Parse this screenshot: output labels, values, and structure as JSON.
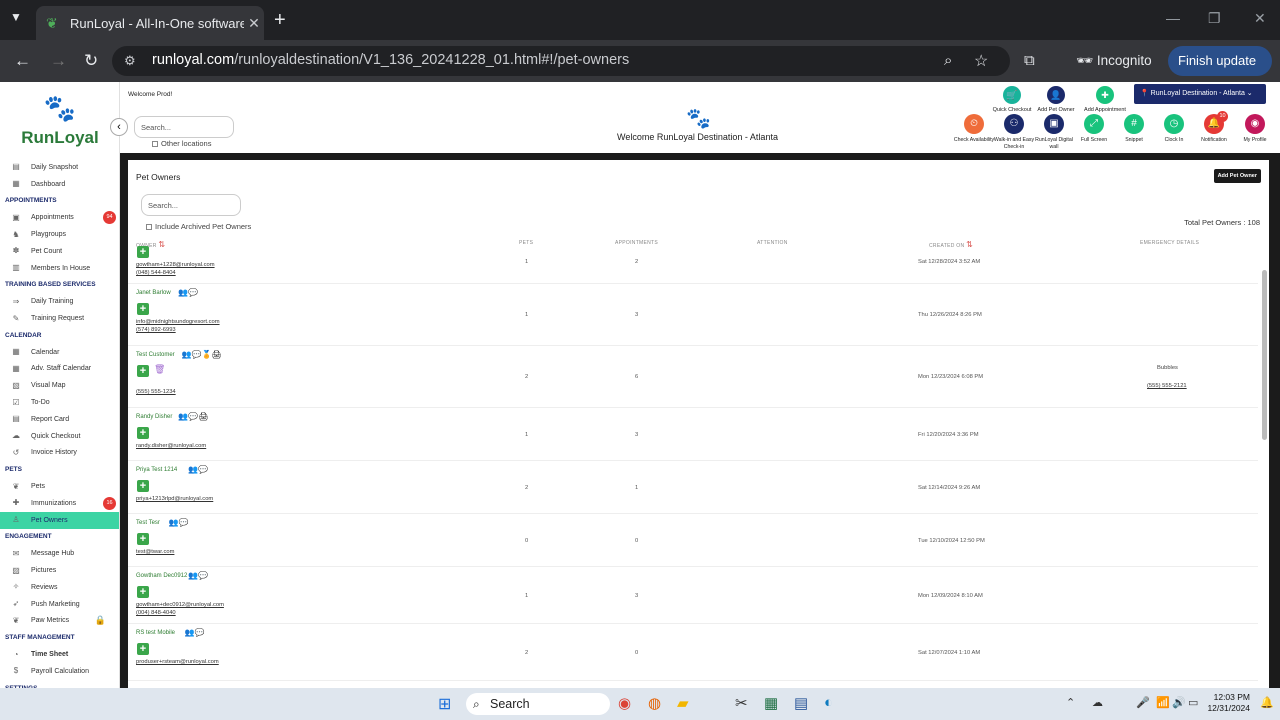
{
  "browser": {
    "tab_title": "RunLoyal - All-In-One software",
    "url_host": "runloyal.com",
    "url_path": "/runloyaldestination/V1_136_20241228_01.html#!/pet-owners",
    "incognito_label": "Incognito",
    "update_label": "Finish update"
  },
  "sidebar": {
    "logo_text": "RunLoyal",
    "items": [
      {
        "type": "item",
        "label": "Daily Snapshot",
        "icon": "snapshot-icon"
      },
      {
        "type": "item",
        "label": "Dashboard",
        "icon": "dashboard-icon"
      },
      {
        "type": "section",
        "label": "APPOINTMENTS"
      },
      {
        "type": "item",
        "label": "Appointments",
        "icon": "appointments-icon",
        "badge": "94"
      },
      {
        "type": "item",
        "label": "Playgroups",
        "icon": "playgroups-icon"
      },
      {
        "type": "item",
        "label": "Pet Count",
        "icon": "pet-count-icon"
      },
      {
        "type": "item",
        "label": "Members In House",
        "icon": "members-icon"
      },
      {
        "type": "section",
        "label": "TRAINING BASED SERVICES"
      },
      {
        "type": "item",
        "label": "Daily Training",
        "icon": "training-icon"
      },
      {
        "type": "item",
        "label": "Training Request",
        "icon": "training-request-icon"
      },
      {
        "type": "section",
        "label": "CALENDAR"
      },
      {
        "type": "item",
        "label": "Calendar",
        "icon": "calendar-icon"
      },
      {
        "type": "item",
        "label": "Adv. Staff Calendar",
        "icon": "staff-calendar-icon"
      },
      {
        "type": "item",
        "label": "Visual Map",
        "icon": "map-icon"
      },
      {
        "type": "item",
        "label": "To-Do",
        "icon": "todo-icon"
      },
      {
        "type": "item",
        "label": "Report Card",
        "icon": "report-card-icon"
      },
      {
        "type": "item",
        "label": "Quick Checkout",
        "icon": "checkout-icon"
      },
      {
        "type": "item",
        "label": "Invoice History",
        "icon": "invoice-icon"
      },
      {
        "type": "section",
        "label": "PETS"
      },
      {
        "type": "item",
        "label": "Pets",
        "icon": "pets-icon"
      },
      {
        "type": "item",
        "label": "Immunizations",
        "icon": "immunizations-icon",
        "badge": "16"
      },
      {
        "type": "item",
        "label": "Pet Owners",
        "icon": "pet-owners-icon",
        "active": true
      },
      {
        "type": "section",
        "label": "ENGAGEMENT"
      },
      {
        "type": "item",
        "label": "Message Hub",
        "icon": "message-icon"
      },
      {
        "type": "item",
        "label": "Pictures",
        "icon": "pictures-icon"
      },
      {
        "type": "item",
        "label": "Reviews",
        "icon": "reviews-icon"
      },
      {
        "type": "item",
        "label": "Push Marketing",
        "icon": "marketing-icon"
      },
      {
        "type": "item",
        "label": "Paw Metrics",
        "icon": "paw-metrics-icon",
        "locked": true
      },
      {
        "type": "section",
        "label": "STAFF MANAGEMENT"
      },
      {
        "type": "item",
        "label": "Time Sheet",
        "icon": "timesheet-icon",
        "bold": true
      },
      {
        "type": "item",
        "label": "Payroll Calculation",
        "icon": "payroll-icon"
      },
      {
        "type": "section",
        "label": "SETTINGS"
      }
    ]
  },
  "topbar": {
    "welcome_user": "Welcome Prod!",
    "search_placeholder": "Search...",
    "other_locations": "Other locations",
    "center_title": "Welcome RunLoyal Destination - Atlanta",
    "location": "RunLoyal Destination - Atlanta",
    "quick_actions": [
      {
        "label": "Quick Checkout",
        "color": "#19b39b"
      },
      {
        "label": "Add Pet Owner",
        "color": "#1b2a6b"
      },
      {
        "label": "Add Appointment",
        "color": "#19c37d"
      }
    ],
    "tools": [
      {
        "label": "Check Availability",
        "color": "#ef6c3a",
        "badge": ""
      },
      {
        "label": "Walk-in and Easy Check-in",
        "color": "#1b2a6b",
        "badge": ""
      },
      {
        "label": "RunLoyal Digital wall",
        "color": "#1b2a6b",
        "badge": ""
      },
      {
        "label": "Full Screen",
        "color": "#19c37d",
        "badge": ""
      },
      {
        "label": "Snippet",
        "color": "#19c37d",
        "badge": ""
      },
      {
        "label": "Clock In",
        "color": "#19c37d",
        "badge": ""
      },
      {
        "label": "Notification",
        "color": "#e53935",
        "badge": "10"
      },
      {
        "label": "My Profile",
        "color": "#c2185b",
        "badge": ""
      }
    ]
  },
  "panel": {
    "title": "Pet Owners",
    "add_button": "Add Pet Owner",
    "search_placeholder": "Search...",
    "include_archived": "Include Archived Pet Owners",
    "total": "Total Pet Owners : 108",
    "columns": {
      "owner": "OWNER",
      "pets": "PETS",
      "appointments": "APPOINTMENTS",
      "attention": "ATTENTION",
      "created": "CREATED ON",
      "emergency": "EMERGENCY DETAILS"
    },
    "rows": [
      {
        "name": "",
        "email": "gowtham+1228@runloyal.com",
        "phone": "(048) 544-8404",
        "pets": "1",
        "appointments": "2",
        "created": "Sat 12/28/2024 3:52 AM",
        "em_name": "",
        "em_phone": "",
        "icons": "",
        "trash": false
      },
      {
        "name": "Janet Barlow",
        "email": "info@midnightsundogresort.com",
        "phone": "(574) 892-6993",
        "pets": "1",
        "appointments": "3",
        "created": "Thu 12/26/2024 8:26 PM",
        "em_name": "",
        "em_phone": "",
        "icons": "👥💬",
        "trash": false
      },
      {
        "name": "Test Customer",
        "email": "",
        "phone": "(555) 555-1234",
        "pets": "2",
        "appointments": "6",
        "created": "Mon 12/23/2024 6:08 PM",
        "em_name": "Bubbles",
        "em_phone": "(555) 555-2121",
        "icons": "👥💬🏅🖨",
        "trash": true
      },
      {
        "name": "Randy Disher",
        "email": "randy.disher@runloyal.com",
        "phone": "",
        "pets": "1",
        "appointments": "3",
        "created": "Fri 12/20/2024 3:36 PM",
        "em_name": "",
        "em_phone": "",
        "icons": "👥💬🖨",
        "trash": false
      },
      {
        "name": "Priya Test 1214",
        "email": "priya+1213rlpd@runloyal.com",
        "phone": "",
        "pets": "2",
        "appointments": "1",
        "created": "Sat 12/14/2024 9:26 AM",
        "em_name": "",
        "em_phone": "",
        "icons": "👥💬",
        "trash": false
      },
      {
        "name": "Test Tesr",
        "email": "test@twar.com",
        "phone": "",
        "pets": "0",
        "appointments": "0",
        "created": "Tue 12/10/2024 12:50 PM",
        "em_name": "",
        "em_phone": "",
        "icons": "👥💬",
        "trash": false
      },
      {
        "name": "Gowtham Dec0912",
        "email": "gowtham+dec0912@runloyal.com",
        "phone": "(004) 848-4040",
        "pets": "1",
        "appointments": "3",
        "created": "Mon 12/09/2024 8:10 AM",
        "em_name": "",
        "em_phone": "",
        "icons": "👥💬",
        "trash": false
      },
      {
        "name": "RS test Mobile",
        "email": "produser+rsteam@runloyal.com",
        "phone": "",
        "pets": "2",
        "appointments": "0",
        "created": "Sat 12/07/2024 1:10 AM",
        "em_name": "",
        "em_phone": "",
        "icons": "👥💬",
        "trash": false
      }
    ]
  },
  "taskbar": {
    "search_label": "Search",
    "time": "12:03 PM",
    "date": "12/31/2024"
  }
}
